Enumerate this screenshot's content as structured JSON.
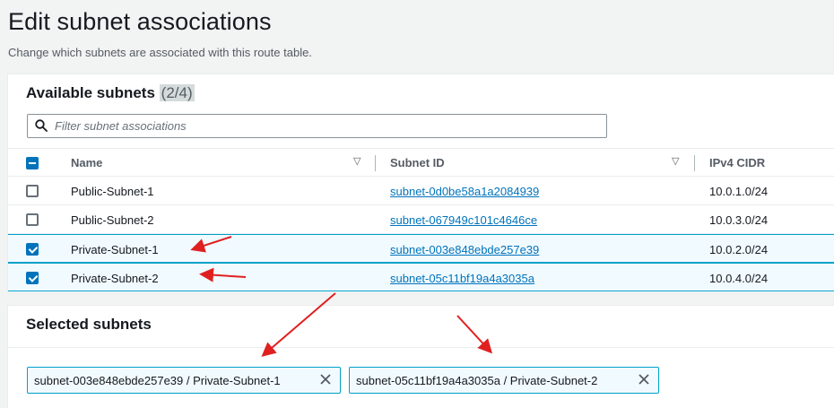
{
  "page": {
    "title": "Edit subnet associations",
    "description": "Change which subnets are associated with this route table."
  },
  "available": {
    "header": "Available subnets",
    "count": "(2/4)",
    "filter_placeholder": "Filter subnet associations",
    "columns": {
      "name": "Name",
      "subnet_id": "Subnet ID",
      "cidr": "IPv4 CIDR"
    },
    "rows": [
      {
        "name": "Public-Subnet-1",
        "subnet_id": "subnet-0d0be58a1a2084939",
        "cidr": "10.0.1.0/24",
        "checked": false
      },
      {
        "name": "Public-Subnet-2",
        "subnet_id": "subnet-067949c101c4646ce",
        "cidr": "10.0.3.0/24",
        "checked": false
      },
      {
        "name": "Private-Subnet-1",
        "subnet_id": "subnet-003e848ebde257e39",
        "cidr": "10.0.2.0/24",
        "checked": true
      },
      {
        "name": "Private-Subnet-2",
        "subnet_id": "subnet-05c11bf19a4a3035a",
        "cidr": "10.0.4.0/24",
        "checked": true
      }
    ]
  },
  "selected": {
    "header": "Selected subnets",
    "tokens": [
      "subnet-003e848ebde257e39 / Private-Subnet-1",
      "subnet-05c11bf19a4a3035a / Private-Subnet-2"
    ]
  },
  "colors": {
    "link": "#0073bb",
    "accent": "#00a1c9",
    "annotation": "#e02020"
  }
}
